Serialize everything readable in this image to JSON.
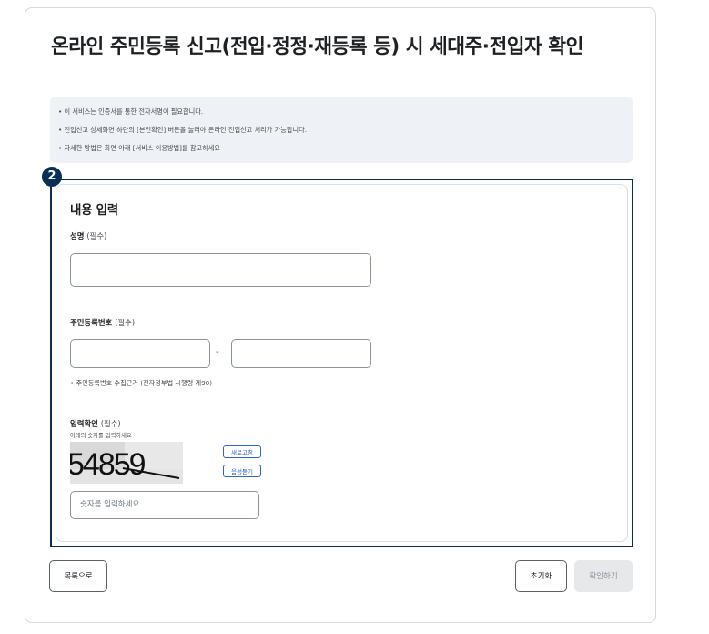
{
  "page": {
    "title": "온라인 주민등록 신고(전입·정정·재등록 등) 시 세대주·전입자 확인"
  },
  "notice": {
    "lines": [
      "• 이 서비스는 인증서를 통한 전자서명이 필요합니다.",
      "• 전입신고 상세화면 하단의 [본인확인] 버튼을 눌러야 온라인 전입신고 처리가 가능합니다.",
      "• 자세한 방법은 화면 아래 [서비스 이용방법]를 참고하세요"
    ]
  },
  "step_badge": "2",
  "form": {
    "section_title": "내용 입력",
    "name": {
      "label": "성명",
      "required": "(필수)",
      "value": ""
    },
    "resident_number": {
      "label": "주민등록번호",
      "required": "(필수)",
      "separator": "-",
      "front_value": "",
      "back_value": "",
      "hint": "• 주민등록번호 수집근거 (전자정부법 시행령 제90)"
    },
    "captcha": {
      "label": "입력확인",
      "required": "(필수)",
      "instruction": "아래의 숫자를 입력하세요",
      "image_text": "54859",
      "refresh_label": "새로고침",
      "audio_label": "음성듣기",
      "placeholder": "숫자를 입력하세요"
    }
  },
  "buttons": {
    "list": "목록으로",
    "reset": "초기화",
    "confirm": "확인하기"
  },
  "colors": {
    "accent_navy": "#0b2e55",
    "link_blue": "#2a66c2",
    "notice_bg": "#eef1f5"
  }
}
